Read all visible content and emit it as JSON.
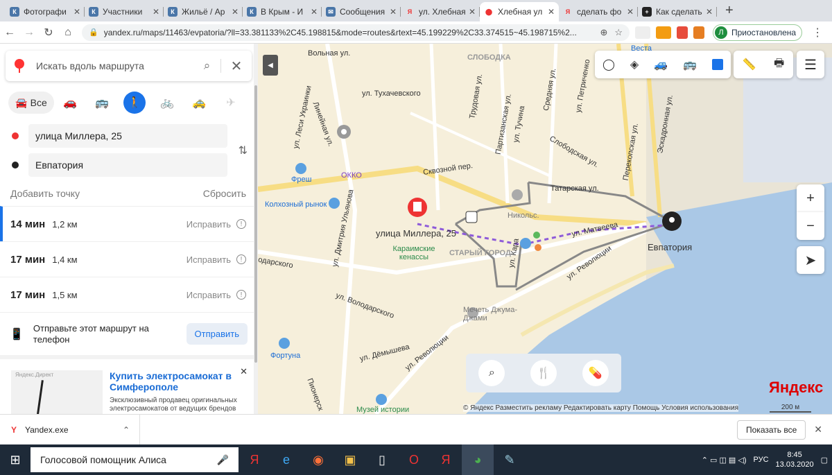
{
  "browser": {
    "tabs": [
      {
        "title": "Фотографи",
        "icon": "vk-icon",
        "color": "#4a76a8"
      },
      {
        "title": "Участники",
        "icon": "vk-icon",
        "color": "#4a76a8"
      },
      {
        "title": "Жильё / Ар",
        "icon": "vk-icon",
        "color": "#4a76a8"
      },
      {
        "title": "В Крым - И",
        "icon": "vk-icon",
        "color": "#4a76a8"
      },
      {
        "title": "Сообщения",
        "icon": "chat-icon",
        "color": "#4a76a8"
      },
      {
        "title": "ул. Хлебная",
        "icon": "yandex-icon",
        "color": "#e33"
      },
      {
        "title": "Хлебная ул",
        "icon": "yandex-maps-icon",
        "color": "#e33"
      },
      {
        "title": "сделать фо",
        "icon": "yandex-icon",
        "color": "#e33"
      },
      {
        "title": "Как сделать",
        "icon": "plus-square-icon",
        "color": "#222"
      }
    ],
    "url": "yandex.ru/maps/11463/evpatoria/?ll=33.381133%2C45.198815&mode=routes&rtext=45.199229%2C33.374515~45.198715%2...",
    "profile_initial": "Л",
    "profile_label": "Приостановлена"
  },
  "sidebar": {
    "search_placeholder": "Искать вдоль маршрута",
    "mode_all": "Все",
    "from": "улица Миллера, 25",
    "to": "Евпатория",
    "add_point": "Добавить точку",
    "reset": "Сбросить",
    "routes": [
      {
        "time": "14 мин",
        "dist": "1,2 км",
        "fix": "Исправить"
      },
      {
        "time": "17 мин",
        "dist": "1,4 км",
        "fix": "Исправить"
      },
      {
        "time": "17 мин",
        "dist": "1,5 км",
        "fix": "Исправить"
      }
    ],
    "send_text": "Отправьте этот маршрут на телефон",
    "send_button": "Отправить",
    "ad": {
      "badge": "Яндекс.Директ",
      "title": "Купить электросамокат в Симферополе",
      "desc": "Эксклюзивный продавец оригинальных электросамокатов от ведущих брендов"
    }
  },
  "map": {
    "labels": [
      "Вольная ул.",
      "СЛОБОДКА",
      "ул. Тухачевского",
      "ул. Леси Украинки",
      "Линейная ул.",
      "Трудовая ул.",
      "Партизанская ул.",
      "ул. Тучина",
      "Средняя ул.",
      "ул. Петриченко",
      "Слободская ул.",
      "Эскадронная ул.",
      "Сквозной пер.",
      "Перекопская ул.",
      "Татарская ул.",
      "Фреш",
      "ОККО",
      "Колхозный рынок",
      "ул. Дмитрия Ульянова",
      "Никольс.",
      "Караимские кенассы",
      "СТАРЫЙ ГОРОД",
      "ул. Матвеева",
      "ул. Революции",
      "одарского",
      "ул. Володарского",
      "Мечеть Джума-Джами",
      "Фортуна",
      "ул. Дёмышева",
      "ул. Революции",
      "Пионерск",
      "Музей истории",
      "Веста",
      "ул. Кара"
    ],
    "start_label": "улица Миллера, 25",
    "end_label": "Евпатория",
    "logo": "Яндекс",
    "copyright": "© Яндекс   Разместить рекламу   Редактировать карту   Помощь   Условия использования",
    "scale": "200 м"
  },
  "downloads": {
    "file": "Yandex.exe",
    "show_all": "Показать все"
  },
  "taskbar": {
    "assistant": "Голосовой помощник Алиса",
    "lang": "РУС",
    "time": "8:45",
    "date": "13.03.2020"
  }
}
